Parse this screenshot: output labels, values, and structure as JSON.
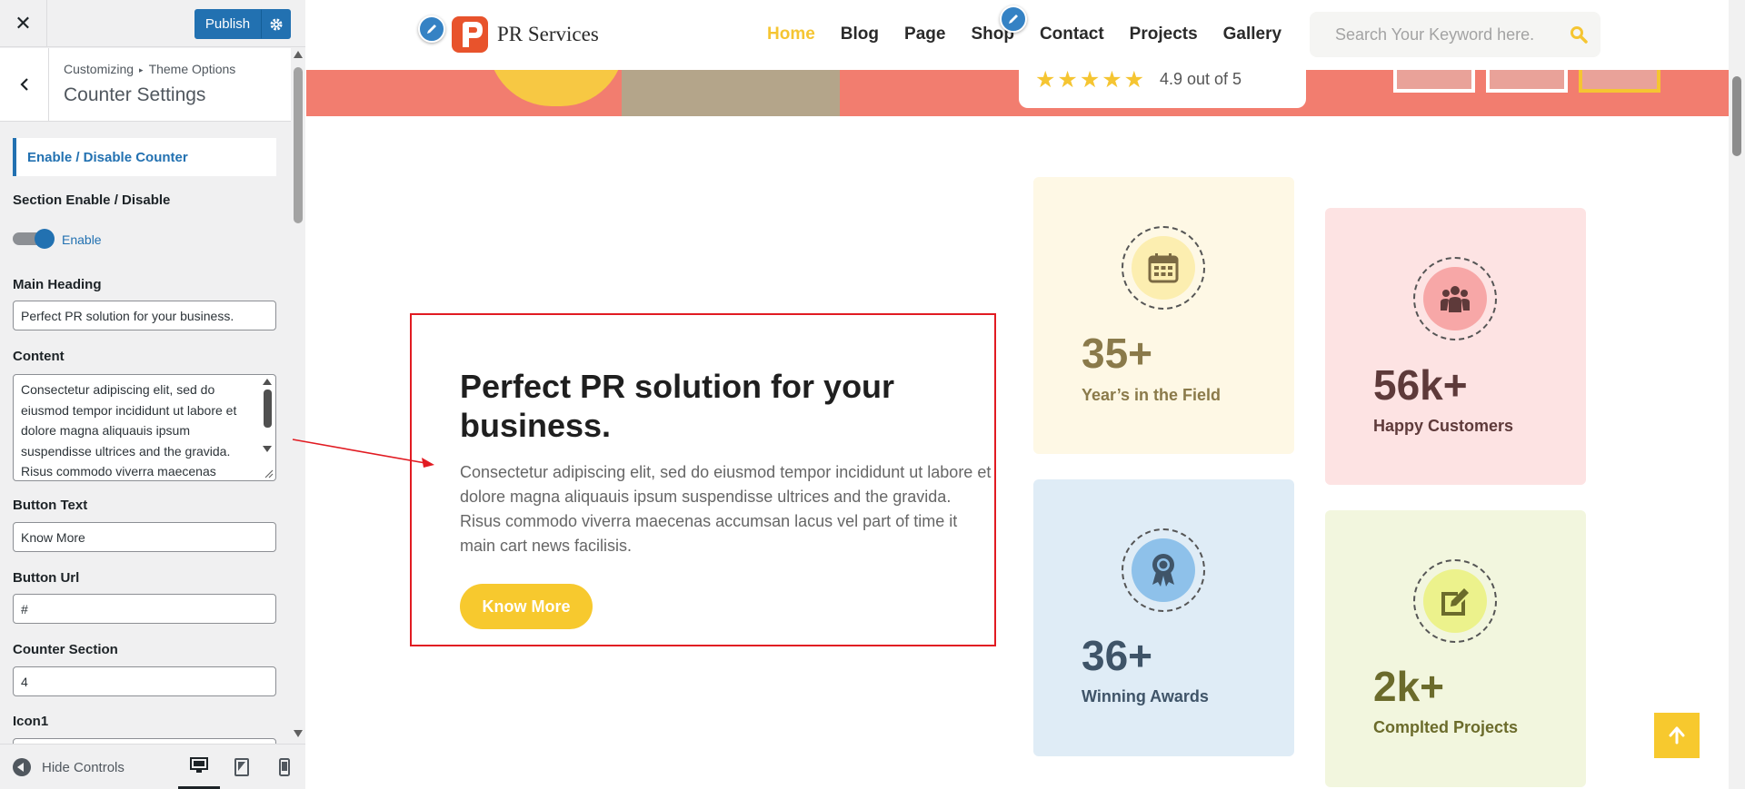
{
  "customizer": {
    "close_icon_glyph": "✕",
    "publish_label": "Publish",
    "breadcrumb": [
      "Customizing",
      "Theme Options"
    ],
    "breadcrumb_separator": "▸",
    "section_title": "Counter Settings",
    "subsection_tab": "Enable / Disable Counter",
    "controls": {
      "section_enable_label": "Section Enable / Disable",
      "toggle_state": "Enable",
      "main_heading_label": "Main Heading",
      "main_heading_value": "Perfect PR solution for your business.",
      "content_label": "Content",
      "content_value": "Consectetur adipiscing elit, sed do eiusmod tempor incididunt ut labore et dolore magna aliquauis ipsum suspendisse ultrices and the gravida. Risus commodo viverra maecenas",
      "button_text_label": "Button Text",
      "button_text_value": "Know More",
      "button_url_label": "Button Url",
      "button_url_value": "#",
      "counter_section_label": "Counter Section",
      "counter_section_value": "4",
      "icon1_label": "Icon1"
    },
    "footer": {
      "hide_controls": "Hide Controls",
      "devices": [
        "desktop-icon",
        "tablet-icon",
        "mobile-icon"
      ],
      "active_device": "desktop"
    },
    "accent_color": "#2271b1"
  },
  "site": {
    "logo_text": "PR Services",
    "menu": [
      "Home",
      "Blog",
      "Page",
      "Shop",
      "Contact",
      "Projects",
      "Gallery"
    ],
    "active_menu": "Home",
    "search_placeholder": "Search Your Keyword here.",
    "rating_stars": "★★★★★",
    "rating_text": "4.9 out of 5",
    "promo": {
      "heading": "Perfect PR solution for your business.",
      "content": "Consectetur adipiscing elit, sed do eiusmod tempor incididunt ut labore et dolore magna aliquauis ipsum suspendisse ultrices and the gravida. Risus commodo viverra maecenas accumsan lacus vel part of time it main cart news facilisis.",
      "button": "Know More"
    },
    "counters": [
      {
        "number": "35",
        "suffix": "+",
        "label": "Year’s in the Field",
        "icon": "calendar-icon",
        "bg": "#fef8e5",
        "circle": "#fceeb0",
        "color": "#7b6a43"
      },
      {
        "number": "56",
        "suffix": "k+",
        "label": "Happy Customers",
        "icon": "people-icon",
        "bg": "#fde3e3",
        "circle": "#f7a7a7",
        "color": "#5e3a3a"
      },
      {
        "number": "36",
        "suffix": "+",
        "label": "Winning Awards",
        "icon": "award-icon",
        "bg": "#dfecf6",
        "circle": "#8ec1ea",
        "color": "#3f5468"
      },
      {
        "number": "2",
        "suffix": "k+",
        "label": "Complted Projects",
        "icon": "edit-note-icon",
        "bg": "#f2f6de",
        "circle": "#ecf28c",
        "color": "#6b6b2b"
      }
    ],
    "brand_yellow": "#f7c92e",
    "highlight_red": "#e11b22"
  }
}
